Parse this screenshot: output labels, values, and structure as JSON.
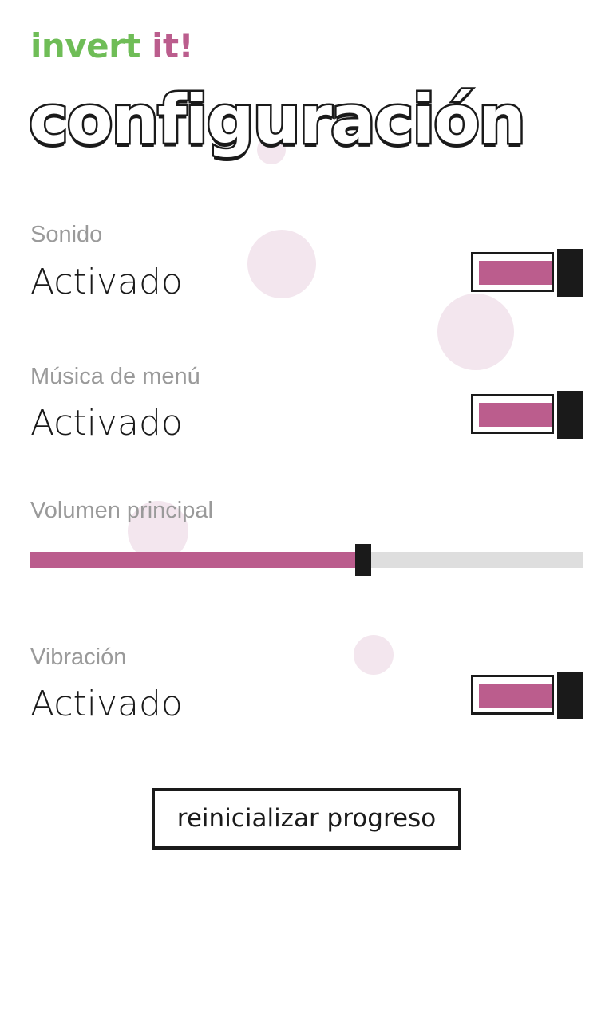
{
  "header": {
    "app_title_part1": "invert",
    "app_title_part2": "it!",
    "page_title": "configuración"
  },
  "settings": {
    "sound": {
      "label": "Sonido",
      "value": "Activado",
      "enabled": true
    },
    "menu_music": {
      "label": "Música de menú",
      "value": "Activado",
      "enabled": true
    },
    "volume": {
      "label": "Volumen principal",
      "level": 0.6
    },
    "vibration": {
      "label": "Vibración",
      "value": "Activado",
      "enabled": true
    }
  },
  "actions": {
    "reset_label": "reinicializar progreso"
  },
  "colors": {
    "accent": "#bb5d8d",
    "green": "#6fbd57",
    "dark": "#1a1a1a",
    "label_gray": "#9a9a9a",
    "rail_gray": "#dedede",
    "bubble": "#f3e6ee"
  }
}
